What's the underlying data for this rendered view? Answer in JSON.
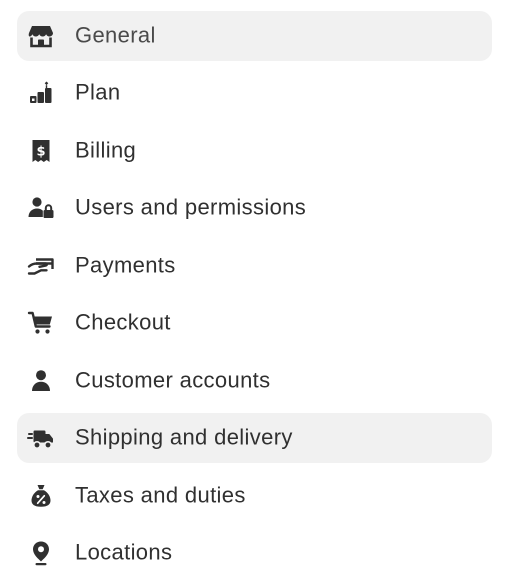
{
  "settings_nav": {
    "items": [
      {
        "label": "General",
        "icon": "store-icon",
        "state": "selected"
      },
      {
        "label": "Plan",
        "icon": "plan-steps-icon",
        "state": "default"
      },
      {
        "label": "Billing",
        "icon": "billing-receipt-icon",
        "state": "default"
      },
      {
        "label": "Users and permissions",
        "icon": "users-lock-icon",
        "state": "default"
      },
      {
        "label": "Payments",
        "icon": "payments-card-icon",
        "state": "default"
      },
      {
        "label": "Checkout",
        "icon": "cart-icon",
        "state": "default"
      },
      {
        "label": "Customer accounts",
        "icon": "person-icon",
        "state": "default"
      },
      {
        "label": "Shipping and delivery",
        "icon": "delivery-truck-icon",
        "state": "hover"
      },
      {
        "label": "Taxes and duties",
        "icon": "tax-bag-icon",
        "state": "default"
      },
      {
        "label": "Locations",
        "icon": "location-pin-icon",
        "state": "default"
      }
    ]
  },
  "colors": {
    "text": "#303030",
    "icon": "#303030",
    "highlight_background": "#f1f1f1"
  }
}
